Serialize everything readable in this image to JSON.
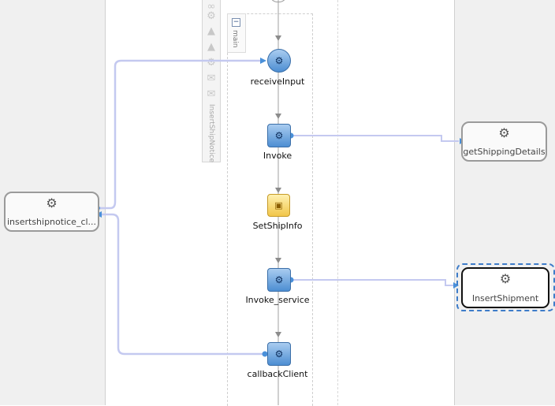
{
  "palette": {
    "label": "InsertShipNotice",
    "icons": [
      "flow-icon",
      "gear-icon",
      "warning-icon",
      "warning-icon",
      "gear-icon",
      "message-icon",
      "envelope-icon"
    ]
  },
  "scope": {
    "label": "main",
    "collapse_symbol": "−"
  },
  "activities": [
    {
      "name": "receive-input-activity",
      "label": "receiveInput",
      "icon": "gear-icon"
    },
    {
      "name": "invoke-activity",
      "label": "Invoke",
      "icon": "gear-icon"
    },
    {
      "name": "setshipinfo-activity",
      "label": "SetShipInfo",
      "icon": "assign-icon"
    },
    {
      "name": "invoke-service-activity",
      "label": "Invoke_service",
      "icon": "gear-icon"
    },
    {
      "name": "callback-client-activity",
      "label": "callbackClient",
      "icon": "gear-icon"
    }
  ],
  "partner_links": {
    "client": {
      "label": "insertshipnotice_cl...",
      "icon": "gear-icon"
    },
    "shipping_details": {
      "label": "getShippingDetails",
      "icon": "gear-icon"
    },
    "insert_shipment": {
      "label": "InsertShipment",
      "icon": "gear-icon",
      "selected": true
    }
  },
  "colors": {
    "wire": "#c4c9f0",
    "arrow": "#4a90d9",
    "lane_bg": "#f0f0f0",
    "selection": "#3d7cc9"
  }
}
